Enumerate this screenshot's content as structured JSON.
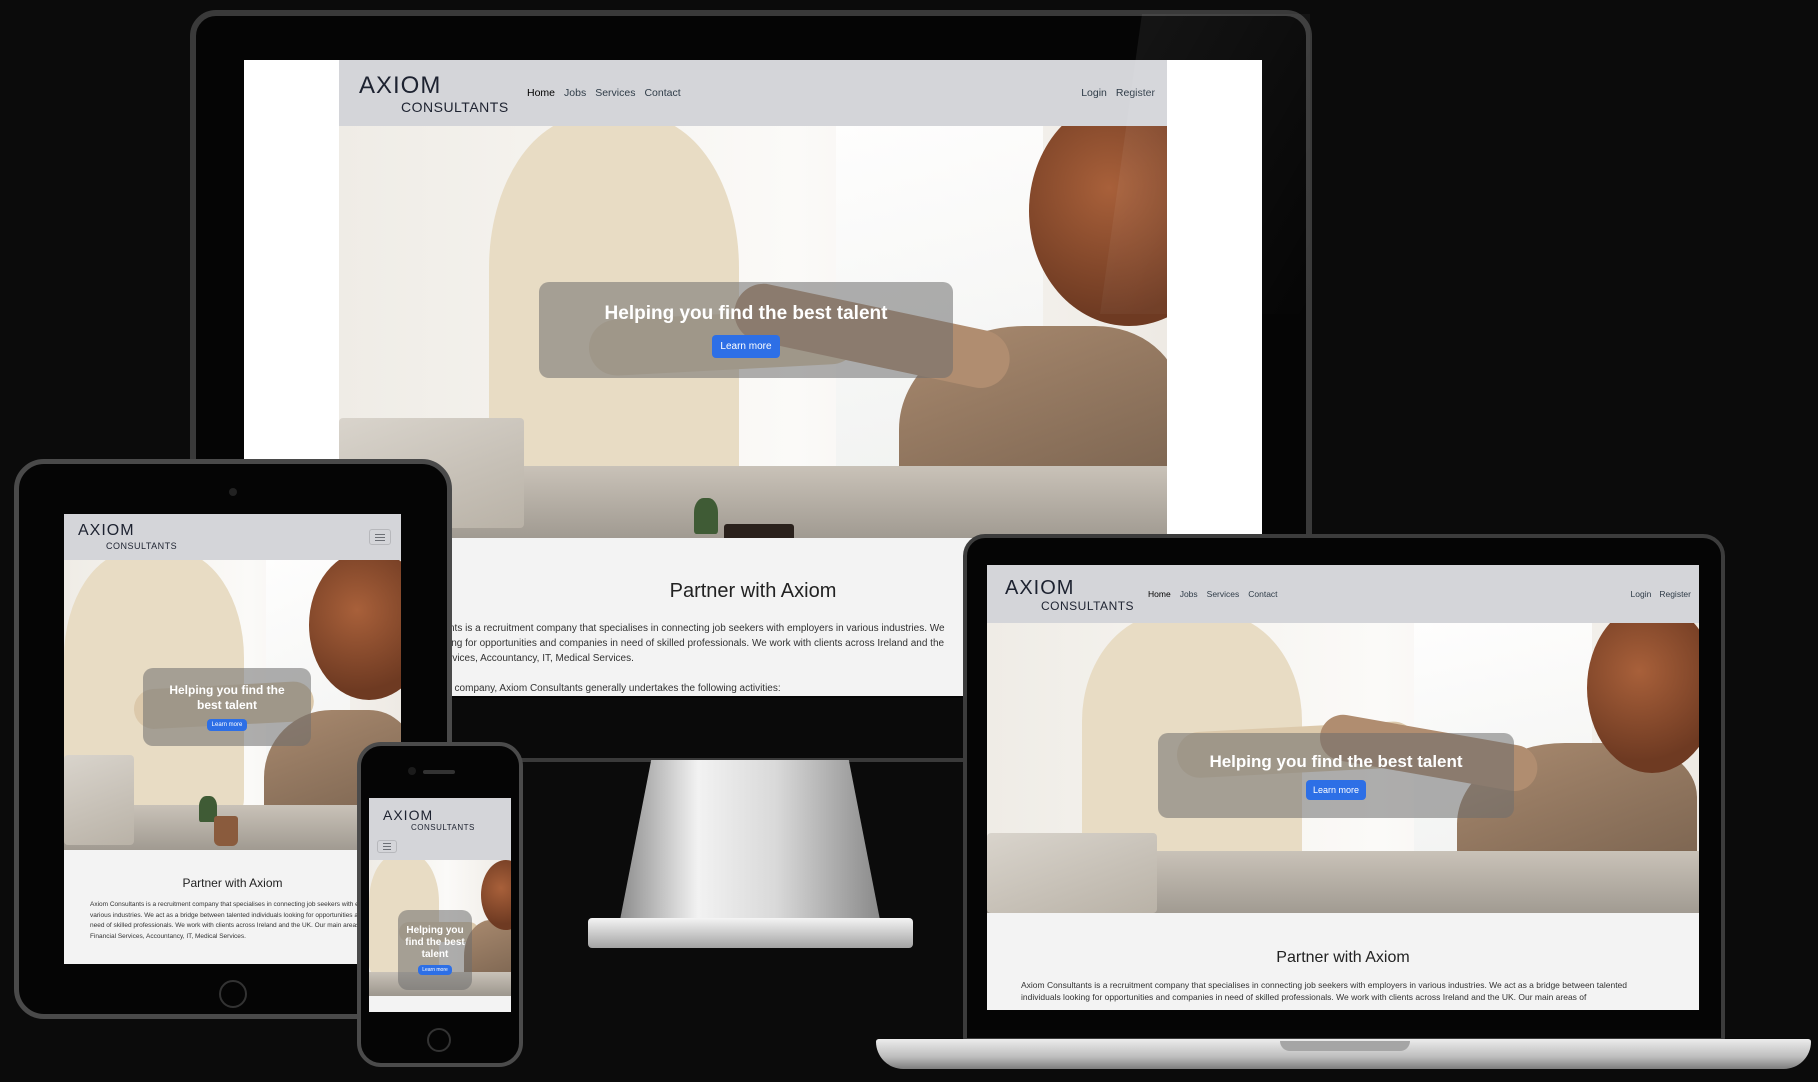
{
  "site": {
    "logo_line1": "AXIOM",
    "logo_line2": "CONSULTANTS",
    "nav": {
      "home": "Home",
      "jobs": "Jobs",
      "services": "Services",
      "contact": "Contact"
    },
    "auth": {
      "login": "Login",
      "register": "Register"
    },
    "hero": {
      "heading": "Helping you find the best talent",
      "button": "Learn more"
    },
    "section_title": "Partner with Axiom",
    "imac_paragraph_1": "nts is a recruitment company that specialises in connecting job seekers with employers in various industries. We act as a bridge between talented individuals looking for opportunities and companies in need of skilled professionals. We work with clients across Ireland and the UK. Our main areas of expertise are Financial Services, Accountancy, IT, Medical Services.",
    "imac_paragraph_1_shown": "nts is a recruitment company that specialises in connecting job seekers with employers in various industries. We",
    "imac_line_2": "ing for opportunities and companies in need of skilled professionals. We work with clients across Ireland and the",
    "imac_line_3": "rvices, Accountancy, IT, Medical Services.",
    "imac_paragraph_2": "t company, Axiom Consultants generally undertakes the following activities:",
    "tablet_paragraph": "Axiom Consultants is a recruitment company that specialises in connecting job seekers with employers in various industries. We act as a bridge between talented individuals looking for opportunities and companies in need of skilled professionals. We work with clients across Ireland and the UK. Our main areas of expertise are Financial Services, Accountancy, IT, Medical Services.",
    "laptop_paragraph": "Axiom Consultants is a recruitment company that specialises in connecting job seekers with employers in various industries. We act as a bridge between talented individuals looking for opportunities and companies in need of skilled professionals. We work with clients across Ireland and the UK. Our main areas of"
  },
  "colors": {
    "nav_bg": "#d4d5d9",
    "button": "#2d6fe6",
    "content_bg": "#f3f3f3",
    "backdrop": "#0b0b0b"
  },
  "icons": {
    "menu": "hamburger-icon"
  }
}
